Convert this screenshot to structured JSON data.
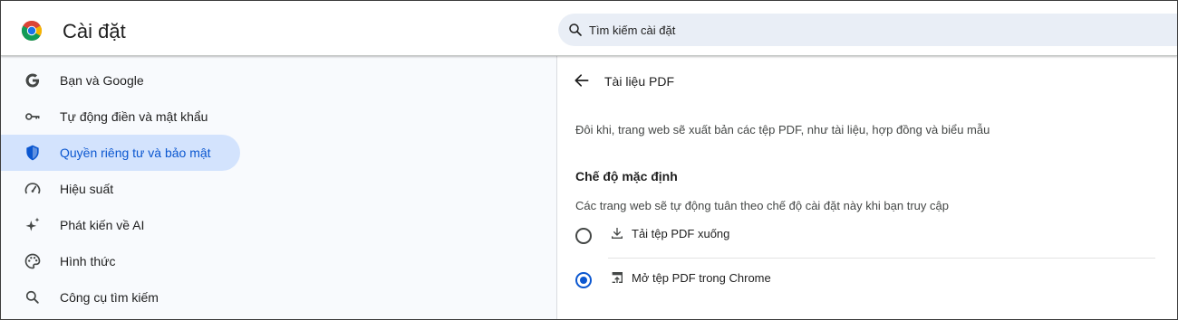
{
  "header": {
    "title": "Cài đặt",
    "logo_icon": "chrome-logo-icon",
    "search": {
      "placeholder": "Tìm kiếm cài đặt",
      "value": "",
      "icon": "search-icon"
    }
  },
  "sidebar": {
    "items": [
      {
        "label": "Bạn và Google",
        "icon": "google-g-icon",
        "active": false
      },
      {
        "label": "Tự động điền và mật khẩu",
        "icon": "key-icon",
        "active": false
      },
      {
        "label": "Quyền riêng tư và bảo mật",
        "icon": "shield-icon",
        "active": true
      },
      {
        "label": "Hiệu suất",
        "icon": "speedometer-icon",
        "active": false
      },
      {
        "label": "Phát kiến về AI",
        "icon": "sparkle-icon",
        "active": false
      },
      {
        "label": "Hình thức",
        "icon": "palette-icon",
        "active": false
      },
      {
        "label": "Công cụ tìm kiếm",
        "icon": "search-icon",
        "active": false
      }
    ]
  },
  "main": {
    "page_title": "Tài liệu PDF",
    "back_icon": "arrow-back-icon",
    "description": "Đôi khi, trang web sẽ xuất bản các tệp PDF, như tài liệu, hợp đồng và biểu mẫu",
    "section_title": "Chế độ mặc định",
    "section_description": "Các trang web sẽ tự động tuân theo chế độ cài đặt này khi bạn truy cập",
    "options": [
      {
        "label": "Tải tệp PDF xuống",
        "icon": "download-icon",
        "checked": false
      },
      {
        "label": "Mở tệp PDF trong Chrome",
        "icon": "open-in-browser-icon",
        "checked": true
      }
    ]
  },
  "colors": {
    "accent": "#0b57d0",
    "active_nav_bg": "#d3e3fd",
    "search_bg": "#e9eef6",
    "page_bg": "#f8fafd"
  }
}
